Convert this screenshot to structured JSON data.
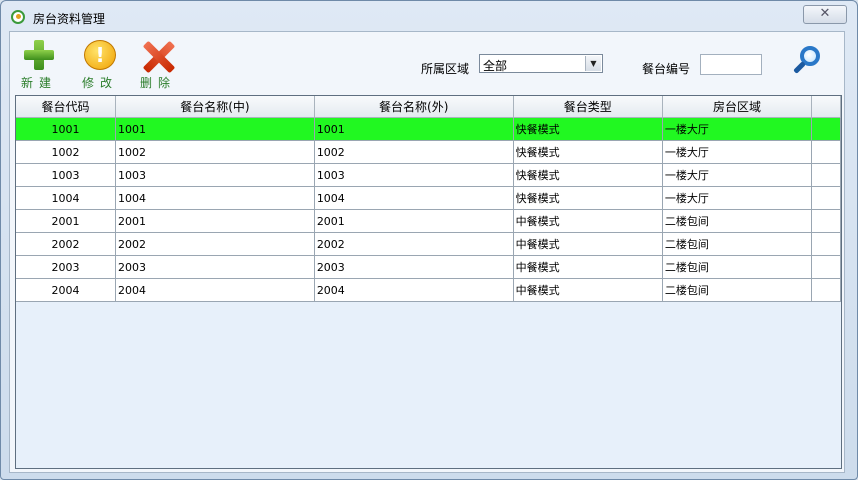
{
  "window": {
    "title": "房台资料管理",
    "close_glyph": "✕"
  },
  "toolbar": {
    "new_label": "新建",
    "edit_label": "修改",
    "delete_label": "删除",
    "area_label": "所属区域",
    "area_value": "全部",
    "table_no_label": "餐台编号",
    "table_no_value": ""
  },
  "icons": [
    "app-icon",
    "plus-icon",
    "warning-icon",
    "delete-x-icon",
    "search-icon",
    "dropdown-arrow-icon"
  ],
  "colors": {
    "selected_row": "#21f821",
    "toolbar_label": "#2a7d2a"
  },
  "grid": {
    "columns": [
      "餐台代码",
      "餐台名称(中)",
      "餐台名称(外)",
      "餐台类型",
      "房台区域"
    ],
    "rows": [
      {
        "code": "1001",
        "name_cn": "1001",
        "name_foreign": "1001",
        "type": "快餐模式",
        "area": "一楼大厅"
      },
      {
        "code": "1002",
        "name_cn": "1002",
        "name_foreign": "1002",
        "type": "快餐模式",
        "area": "一楼大厅"
      },
      {
        "code": "1003",
        "name_cn": "1003",
        "name_foreign": "1003",
        "type": "快餐模式",
        "area": "一楼大厅"
      },
      {
        "code": "1004",
        "name_cn": "1004",
        "name_foreign": "1004",
        "type": "快餐模式",
        "area": "一楼大厅"
      },
      {
        "code": "2001",
        "name_cn": "2001",
        "name_foreign": "2001",
        "type": "中餐模式",
        "area": "二楼包间"
      },
      {
        "code": "2002",
        "name_cn": "2002",
        "name_foreign": "2002",
        "type": "中餐模式",
        "area": "二楼包间"
      },
      {
        "code": "2003",
        "name_cn": "2003",
        "name_foreign": "2003",
        "type": "中餐模式",
        "area": "二楼包间"
      },
      {
        "code": "2004",
        "name_cn": "2004",
        "name_foreign": "2004",
        "type": "中餐模式",
        "area": "二楼包间"
      }
    ]
  }
}
